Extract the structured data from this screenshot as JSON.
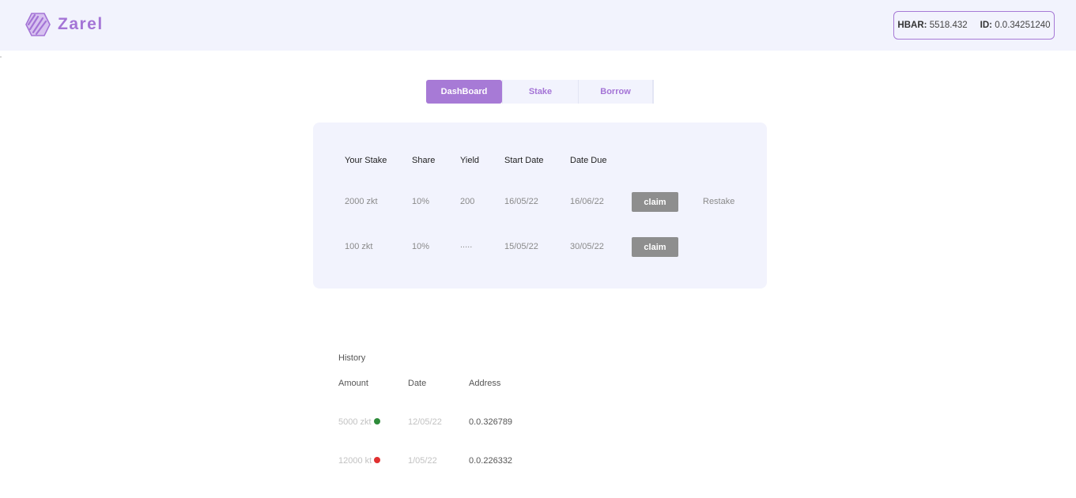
{
  "brand": {
    "name": "Zarel",
    "logo_icon": "zarel-logo-icon",
    "accent": "#a77ad6"
  },
  "account": {
    "hbar_label": "HBAR:",
    "hbar_value": "5518.432",
    "id_label": "ID:",
    "id_value": "0.0.34251240"
  },
  "tabs": [
    {
      "label": "DashBoard",
      "active": true
    },
    {
      "label": "Stake",
      "active": false
    },
    {
      "label": "Borrow",
      "active": false
    }
  ],
  "stakes": {
    "columns": [
      "Your Stake",
      "Share",
      "Yield",
      "Start Date",
      "Date Due"
    ],
    "rows": [
      {
        "stake": "2000 zkt",
        "share": "10%",
        "yield": "200",
        "start": "16/05/22",
        "due": "16/06/22",
        "claim": "claim",
        "restake": "Restake"
      },
      {
        "stake": "100 zkt",
        "share": "10%",
        "yield": ".....",
        "start": "15/05/22",
        "due": "30/05/22",
        "claim": "claim"
      }
    ]
  },
  "history": {
    "title": "History",
    "columns": [
      "Amount",
      "Date",
      "Address"
    ],
    "rows": [
      {
        "amount": "5000 zkt",
        "status": "success",
        "status_color": "#2e8b3a",
        "date": "12/05/22",
        "address": "0.0.326789"
      },
      {
        "amount": "12000 kt",
        "status": "failed",
        "status_color": "#e03030",
        "date": "1/05/22",
        "address": "0.0.226332"
      }
    ]
  }
}
